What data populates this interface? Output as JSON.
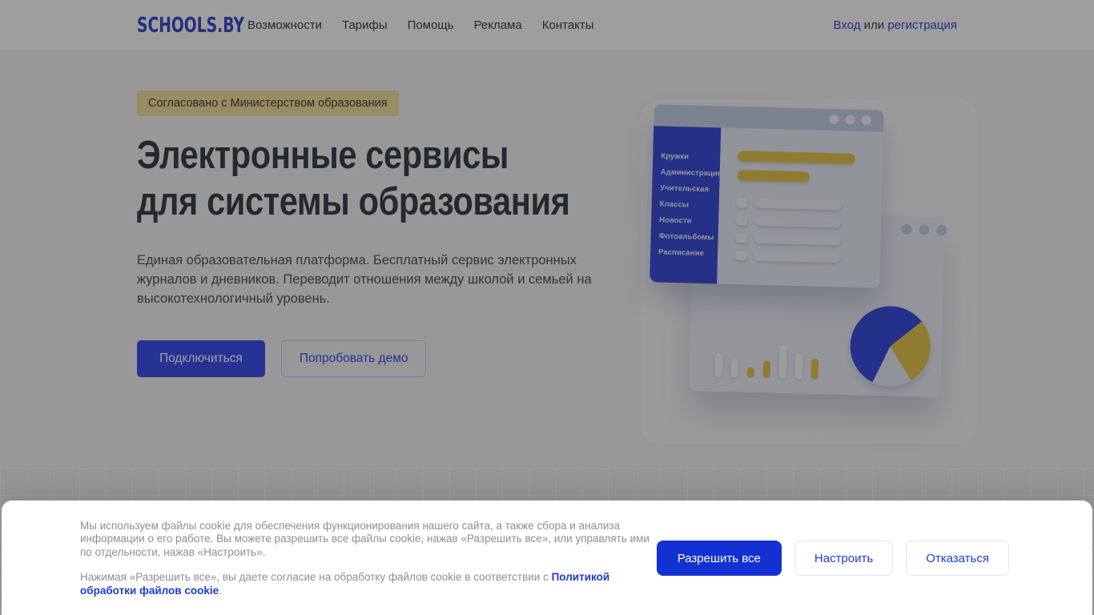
{
  "header": {
    "logo": "SCHOOLS.BY",
    "nav": [
      {
        "label": "Возможности"
      },
      {
        "label": "Тарифы"
      },
      {
        "label": "Помощь"
      },
      {
        "label": "Реклама"
      },
      {
        "label": "Контакты"
      }
    ],
    "auth": {
      "login": "Вход",
      "separator": " или ",
      "register": "регистрация"
    }
  },
  "hero": {
    "badge": "Согласовано с Министерством образования",
    "title_line1": "Электронные сервисы",
    "title_line2": "для системы образования",
    "description": "Единая образовательная платформа. Бесплатный сервис электронных журналов и дневников. Переводит отношения между школой и семьей на высокотехнологичный уровень.",
    "primary_button": "Подключиться",
    "secondary_button": "Попробовать демо"
  },
  "illustration": {
    "menu": [
      "Кружки",
      "Администрация",
      "Учительская",
      "Классы",
      "Новости",
      "Фотоальбомы",
      "Расписание"
    ]
  },
  "cookie_banner": {
    "paragraph1": "Мы используем файлы cookie для обеспечения функционирования нашего сайта, а также сбора и анализа информации о его работе. Вы можете разрешить все файлы cookie, нажав «Разрешить все», или управлять ими по отдельности, нажав «Настроить».",
    "paragraph2_prefix": "Нажимая «Разрешить все», вы даете согласие на обработку файлов cookie в соответствии с ",
    "paragraph2_link": "Политикой обработки файлов cookie",
    "paragraph2_suffix": ".",
    "buttons": {
      "allow_all": "Разрешить все",
      "configure": "Настроить",
      "decline": "Отказаться"
    }
  },
  "colors": {
    "brand_blue": "#3f53ef",
    "cookie_button_blue": "#1331d2",
    "badge_yellow": "#f4e3a0",
    "illustration_yellow": "#e9c84f",
    "sidebar_blue": "#3c50da"
  }
}
